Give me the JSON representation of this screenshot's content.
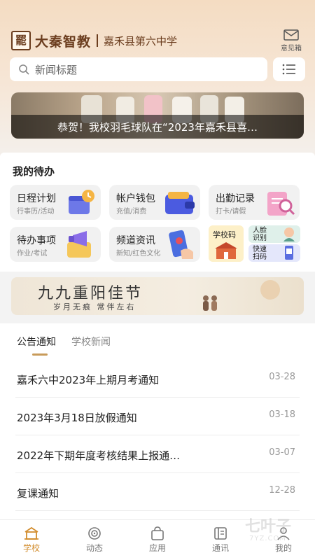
{
  "header": {
    "logo_glyph": "罷",
    "brand": "大秦智教",
    "school": "嘉禾县第六中学",
    "feedback_label": "意见箱",
    "feedback_icon": "envelope-icon",
    "accent": "#6b3d1e"
  },
  "search": {
    "placeholder": "新闻标题",
    "icon": "search-icon",
    "menu_icon": "list-icon"
  },
  "banner": {
    "caption": "恭贺！我校羽毛球队在“2023年嘉禾县喜…"
  },
  "todo": {
    "title": "我的待办",
    "cards": [
      {
        "title": "日程计划",
        "sub": "行事历/活动",
        "icon": "calendar-clock-icon"
      },
      {
        "title": "帐户钱包",
        "sub": "充值/消费",
        "icon": "wallet-icon"
      },
      {
        "title": "出勤记录",
        "sub": "打卡/请假",
        "icon": "attendance-search-icon"
      },
      {
        "title": "待办事项",
        "sub": "作业/考试",
        "icon": "megaphone-icon"
      },
      {
        "title": "频道资讯",
        "sub": "新知/红色文化",
        "icon": "phone-news-icon"
      }
    ],
    "quick": [
      {
        "label": "学校码",
        "icon": "school-building-icon"
      },
      {
        "label": "人脸识别",
        "icon": "face-id-icon"
      },
      {
        "label": "快速扫码",
        "icon": "scan-phone-icon"
      }
    ]
  },
  "promo": {
    "title": "九九重阳佳节",
    "subtitle": "岁月无痕 常伴左右",
    "icon": "elderly-couple-icon"
  },
  "news": {
    "tabs": [
      {
        "label": "公告通知",
        "active": true
      },
      {
        "label": "学校新闻",
        "active": false
      }
    ],
    "items": [
      {
        "title": "嘉禾六中2023年上期月考通知",
        "date": "03-28"
      },
      {
        "title": "2023年3月18日放假通知",
        "date": "03-18"
      },
      {
        "title": "2022年下期年度考核结果上报通…",
        "date": "03-07"
      },
      {
        "title": "复课通知",
        "date": "12-28"
      }
    ]
  },
  "tabbar": {
    "items": [
      {
        "label": "学校",
        "icon": "school-icon",
        "active": true
      },
      {
        "label": "动态",
        "icon": "target-icon",
        "active": false
      },
      {
        "label": "应用",
        "icon": "bag-icon",
        "active": false
      },
      {
        "label": "通讯",
        "icon": "contacts-icon",
        "active": false
      },
      {
        "label": "我的",
        "icon": "user-icon",
        "active": false
      }
    ],
    "active_color": "#d28d2e"
  },
  "watermark": {
    "text": "七叶子",
    "sub": "7YZ.COM"
  }
}
